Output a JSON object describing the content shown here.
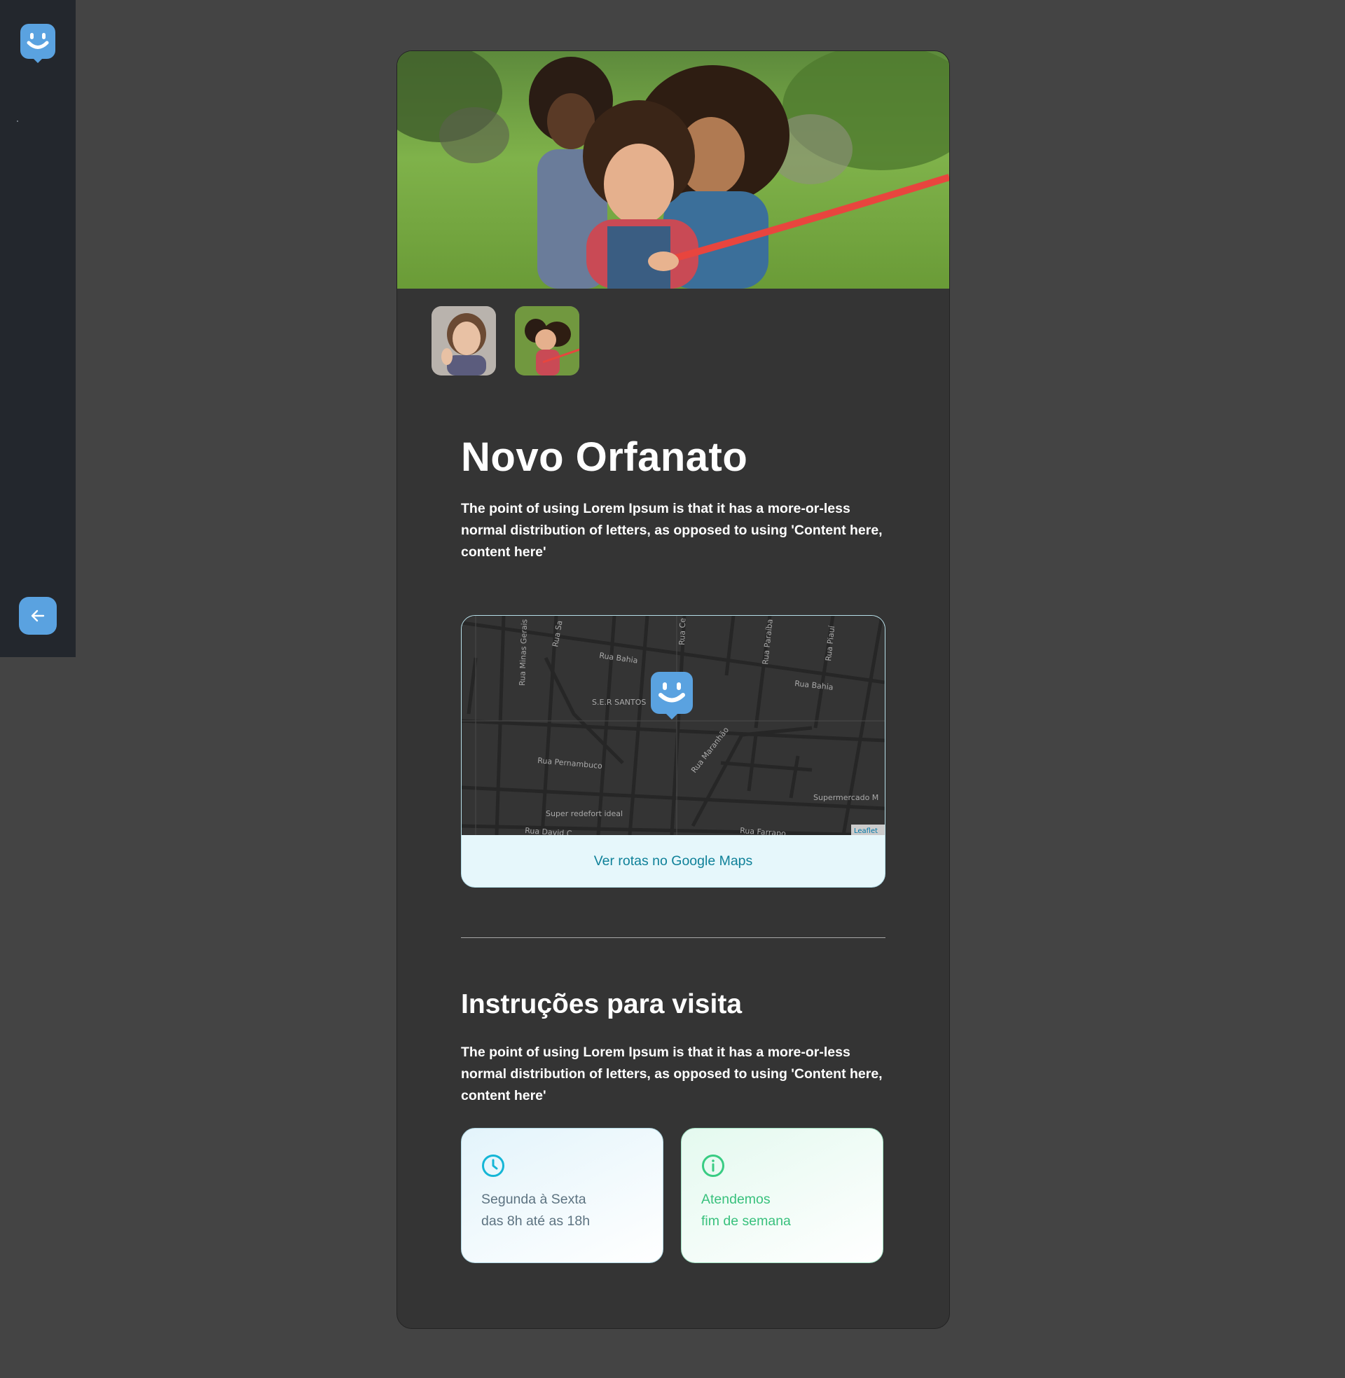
{
  "colors": {
    "page_bg": "#444444",
    "sidebar_bg": "#23272d",
    "card_bg": "#343434",
    "accent_blue": "#5aa2e0",
    "link_teal": "#0f8199",
    "hours_text": "#5d7381",
    "weekend_green": "#39c17d"
  },
  "sidebar": {
    "logo_icon": "happy-marker-icon",
    "back_icon": "arrow-left-icon"
  },
  "orphanage": {
    "name": "Novo Orfanato",
    "about": "The point of using Lorem Ipsum is that it has a more-or-less normal distribution of letters, as opposed to using 'Content here, content here'",
    "images": [
      {
        "alt": "girl-thumbs-up-thumbnail"
      },
      {
        "alt": "kids-tug-of-war-thumbnail"
      }
    ]
  },
  "map": {
    "streets": [
      "Rua Bahia",
      "Rua Bahia",
      "Rua Pernambuco",
      "Rua Maranhão",
      "Rua Minas Gerais",
      "Rua Sa",
      "Rua Ce",
      "Rua Paraíba",
      "Rua Piauí",
      "Rua David C",
      "Rua Farrapo"
    ],
    "places": [
      "S.E.R SANTOS",
      "Super redefort ideal",
      "Supermercado M"
    ],
    "attribution": "Leaflet",
    "directions_link": "Ver rotas no Google Maps"
  },
  "visit": {
    "title": "Instruções para visita",
    "instructions": "The point of using Lorem Ipsum is that it has a more-or-less normal distribution of letters, as opposed to using 'Content here, content here'",
    "hours": {
      "icon": "clock-icon",
      "line1": "Segunda à Sexta",
      "line2": "das 8h até as 18h"
    },
    "weekend": {
      "icon": "info-icon",
      "line1": "Atendemos",
      "line2": "fim de semana"
    }
  }
}
